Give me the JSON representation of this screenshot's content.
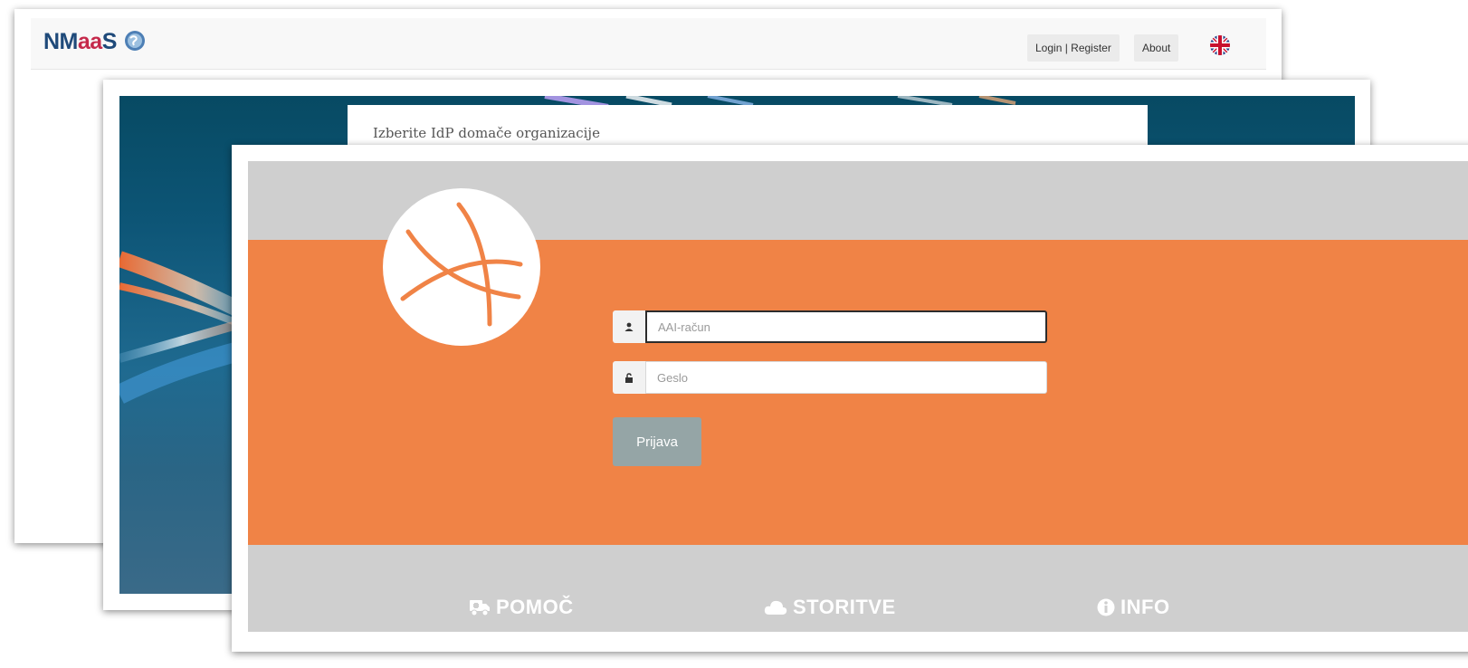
{
  "nmaas": {
    "logo": {
      "part1": "NM",
      "part2": "aa",
      "part3": "S"
    },
    "nav": {
      "login_register": "Login | Register",
      "about": "About"
    },
    "language_icon": "uk-flag-icon"
  },
  "idp": {
    "title": "Izberite IdP domače organizacije"
  },
  "aai_login": {
    "logo_icon": "arnes-orange-logo-icon",
    "username": {
      "placeholder": "AAI-račun",
      "value": "",
      "icon": "user-icon"
    },
    "password": {
      "placeholder": "Geslo",
      "value": "",
      "icon": "lock-icon"
    },
    "submit_label": "Prijava",
    "footer": [
      {
        "label": "POMOČ",
        "icon": "ambulance-icon"
      },
      {
        "label": "STORITVE",
        "icon": "cloud-icon"
      },
      {
        "label": "INFO",
        "icon": "info-circle-icon"
      }
    ]
  },
  "colors": {
    "orange": "#f08346",
    "gray_band": "#cfcfcf",
    "button": "#95a5a6",
    "nmaas_blue": "#1f4a7a",
    "nmaas_red": "#c5294b",
    "idp_bg": "#074a63"
  }
}
